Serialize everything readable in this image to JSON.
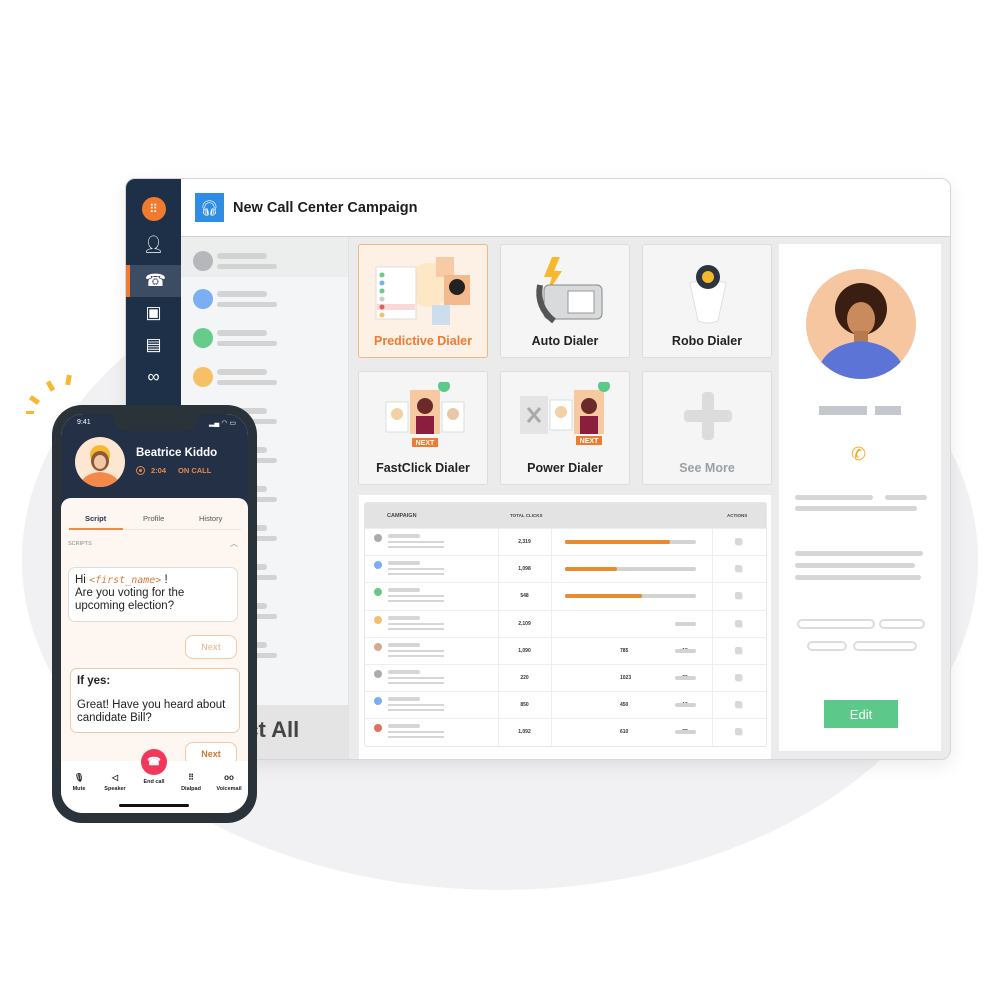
{
  "window": {
    "title": "New Call Center Campaign",
    "select_all": "Select All",
    "header_icon": "headset-icon",
    "sidebar_icons": [
      "logo-icon",
      "user-icon",
      "phone-card-icon",
      "contacts-book-icon",
      "id-card-icon",
      "link-icon"
    ],
    "list_dot_colors": [
      "#b5b7bb",
      "#7aaef5",
      "#66cc8a",
      "#f5c066"
    ]
  },
  "dialers": [
    {
      "label": "Predictive Dialer",
      "selected": true
    },
    {
      "label": "Auto Dialer"
    },
    {
      "label": "Robo Dialer"
    },
    {
      "label": "FastClick Dialer",
      "badge": "NEXT"
    },
    {
      "label": "Power Dialer",
      "badge": "NEXT"
    },
    {
      "label": "See More",
      "icon": "plus-icon"
    }
  ],
  "table": {
    "headers": {
      "campaign": "CAMPAIGN",
      "total_clicks": "TOTAL CLICKS",
      "actions": "ACTIONS"
    },
    "rows": [
      {
        "color": "#a9abae",
        "clicks": "2,319",
        "progress": 0.8
      },
      {
        "color": "#7aaef5",
        "clicks": "1,098",
        "progress": 0.4
      },
      {
        "color": "#6cc584",
        "clicks": "548",
        "progress": 0.59
      },
      {
        "color": "#f0c070",
        "clicks": "2,109"
      },
      {
        "color": "#d5a98a",
        "clicks": "1,090",
        "c2": "785",
        "c3": "18"
      },
      {
        "color": "#a9abae",
        "clicks": "220",
        "c2": "1023",
        "c3": "20"
      },
      {
        "color": "#7aaef5",
        "clicks": "850",
        "c2": "450",
        "c3": "10"
      },
      {
        "color": "#e07060",
        "clicks": "1,092",
        "c2": "610",
        "c3": "22"
      }
    ],
    "accent": "#e88a2e"
  },
  "contact_panel": {
    "edit_label": "Edit",
    "edit_color": "#5cc98a",
    "phone_icon": "phone-icon"
  },
  "phone": {
    "time": "9:41",
    "name": "Beatrice Kiddo",
    "duration": "2:04",
    "status": "ON CALL",
    "tabs": [
      "Script",
      "Profile",
      "History"
    ],
    "section": "SCRIPTS",
    "script1_pre": "Hi ",
    "script1_var": "<first_name>",
    "script1_post": " !",
    "script1_body": "Are you voting for the upcoming election?",
    "next1": "Next",
    "script2_title": "If yes:",
    "script2_body": "Great! Have you heard about candidate Bill?",
    "next2": "Next",
    "actions": [
      "Mute",
      "Speaker",
      "End call",
      "Dialpad",
      "Voicemail"
    ]
  }
}
